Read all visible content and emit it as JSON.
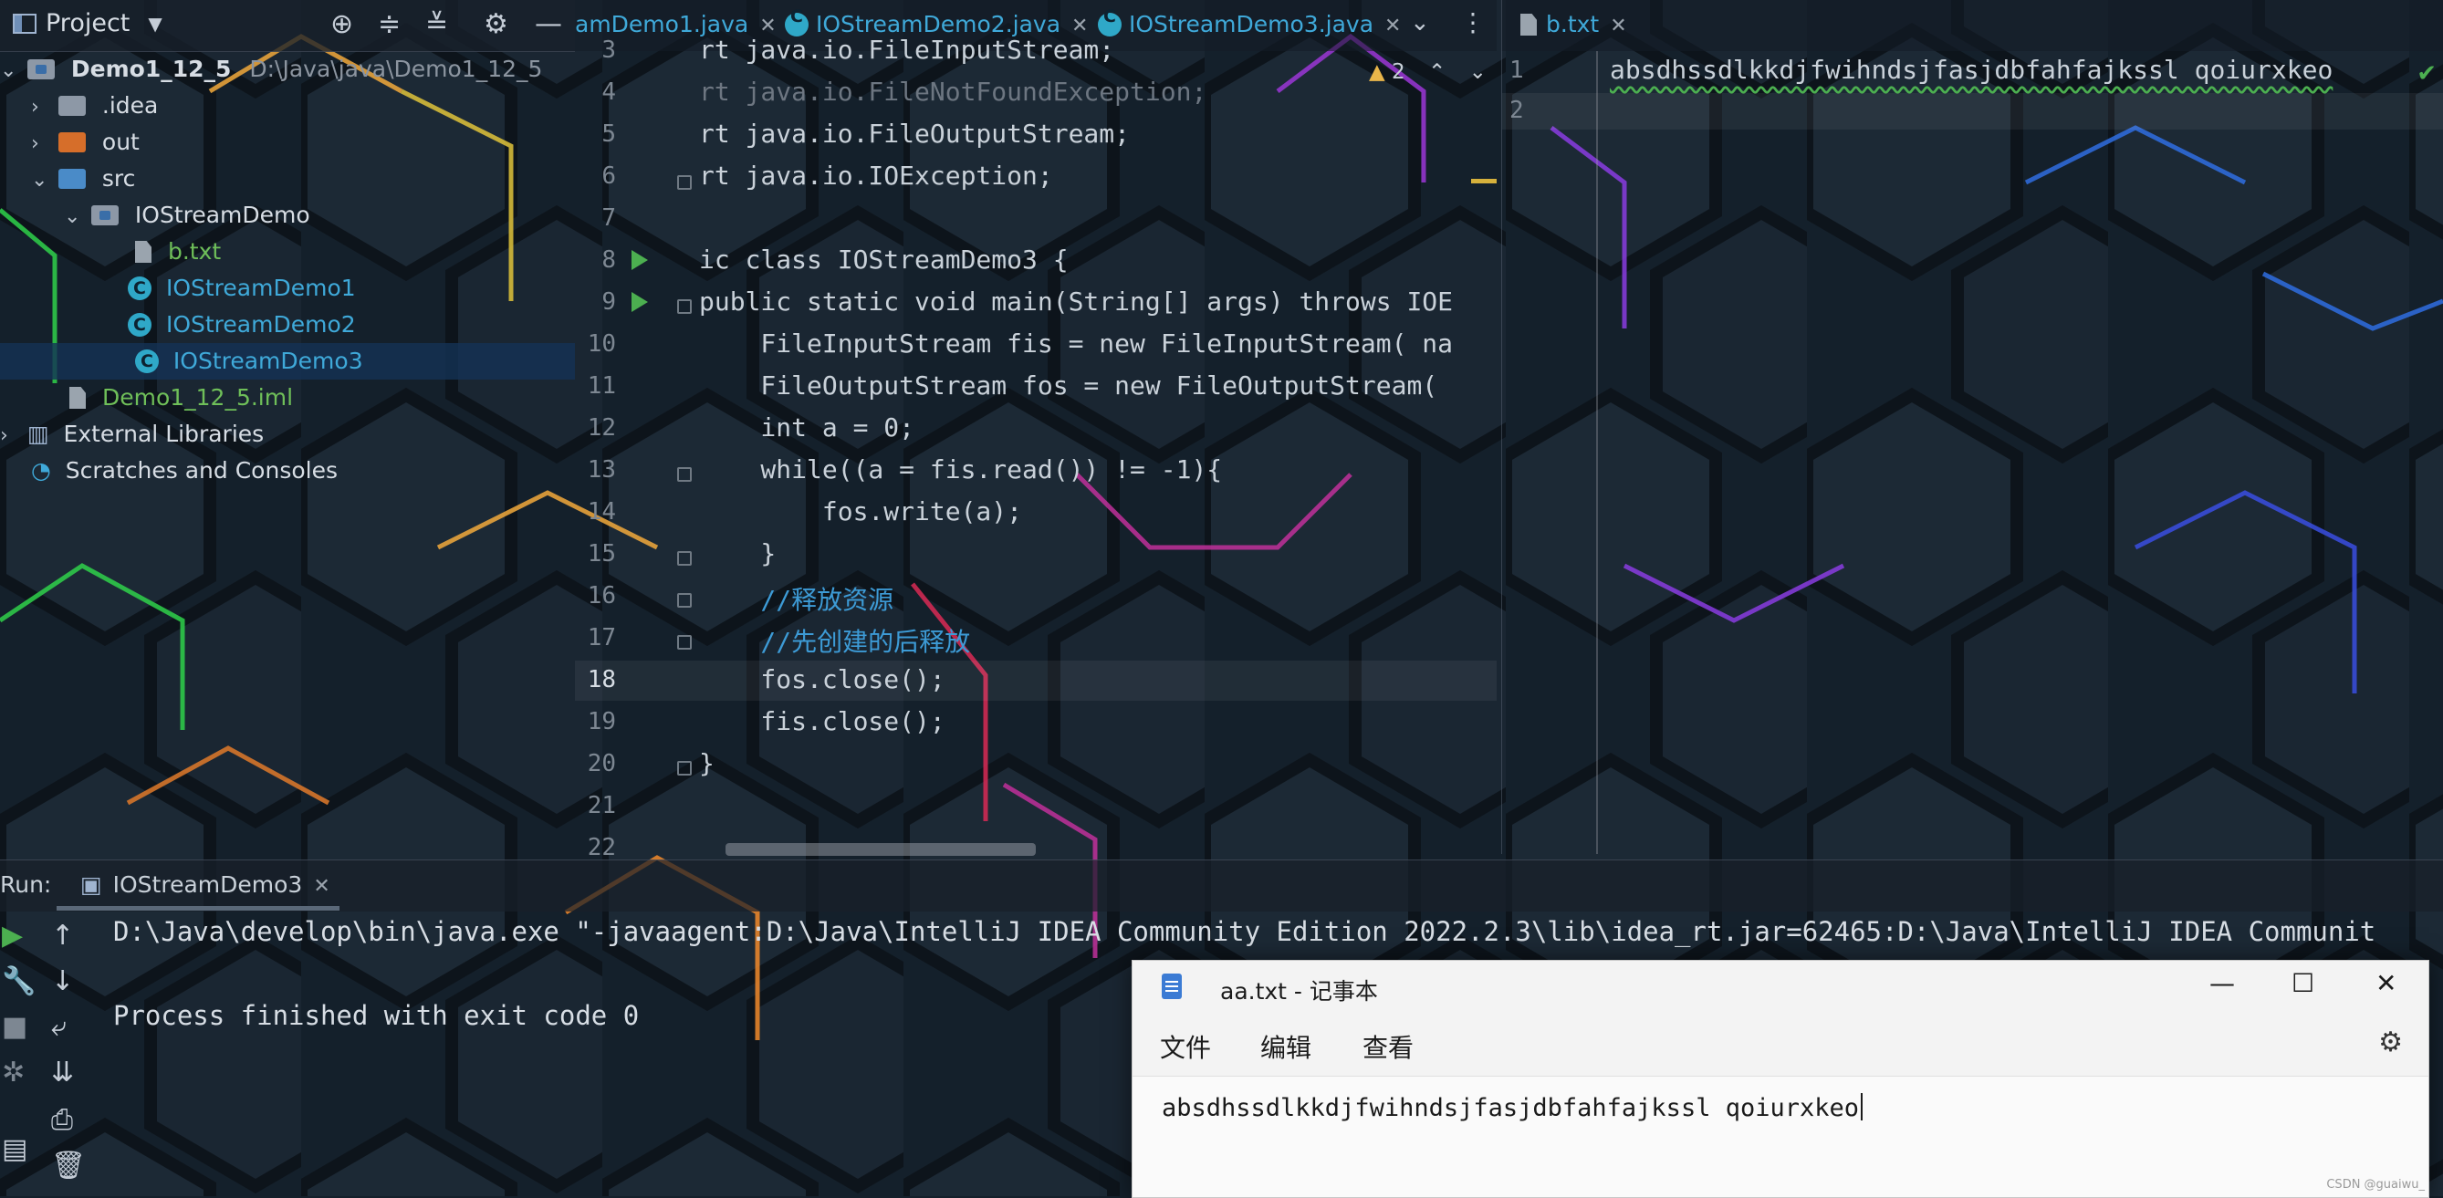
{
  "project_panel": {
    "title": "Project",
    "tree": [
      {
        "label": "Demo1_12_5",
        "path": "D:\\Java\\java\\Demo1_12_5"
      },
      {
        "label": ".idea"
      },
      {
        "label": "out"
      },
      {
        "label": "src"
      },
      {
        "label": "IOStreamDemo"
      },
      {
        "label": "b.txt"
      },
      {
        "label": "IOStreamDemo1"
      },
      {
        "label": "IOStreamDemo2"
      },
      {
        "label": "IOStreamDemo3"
      },
      {
        "label": "Demo1_12_5.iml"
      },
      {
        "label": "External Libraries"
      },
      {
        "label": "Scratches and Consoles"
      }
    ]
  },
  "editor_tabs": [
    {
      "label": "amDemo1.java"
    },
    {
      "label": "IOStreamDemo2.java"
    },
    {
      "label": "IOStreamDemo3.java"
    }
  ],
  "right_tab": {
    "label": "b.txt"
  },
  "editor": {
    "warnings": "2",
    "line_numbers": [
      "3",
      "4",
      "5",
      "6",
      "7",
      "8",
      "9",
      "10",
      "11",
      "12",
      "13",
      "14",
      "15",
      "16",
      "17",
      "18",
      "19",
      "20",
      "21",
      "22"
    ],
    "lines": [
      "rt java.io.FileInputStream;",
      "rt java.io.FileNotFoundException;",
      "rt java.io.FileOutputStream;",
      "rt java.io.IOException;",
      "",
      "ic class IOStreamDemo3 {",
      "public static void main(String[] args) throws IOE",
      "    FileInputStream fis = new FileInputStream( na",
      "    FileOutputStream fos = new FileOutputStream(",
      "    int a = 0;",
      "    while((a = fis.read()) != -1){",
      "        fos.write(a);",
      "    }",
      "    //释放资源",
      "    //先创建的后释放",
      "    fos.close();",
      "    fis.close();",
      "}",
      "",
      ""
    ],
    "active_line": "18"
  },
  "right_editor": {
    "line_numbers": [
      "1",
      "2"
    ],
    "content": "absdhssdlkkdjfwihndsjfasjdbfahfajkssl qoiurxkeo"
  },
  "run_panel": {
    "label": "Run:",
    "tab": "IOStreamDemo3",
    "console": [
      "D:\\Java\\develop\\bin\\java.exe \"-javaagent:D:\\Java\\IntelliJ IDEA Community Edition 2022.2.3\\lib\\idea_rt.jar=62465:D:\\Java\\IntelliJ IDEA Communit",
      "",
      "Process finished with exit code 0"
    ]
  },
  "notepad": {
    "title": "aa.txt - 记事本",
    "menu": [
      "文件",
      "编辑",
      "查看"
    ],
    "content": "absdhssdlkkdjfwihndsjfasjdbfahfajkssl qoiurxkeo",
    "watermark": "CSDN @guaiwu_"
  }
}
